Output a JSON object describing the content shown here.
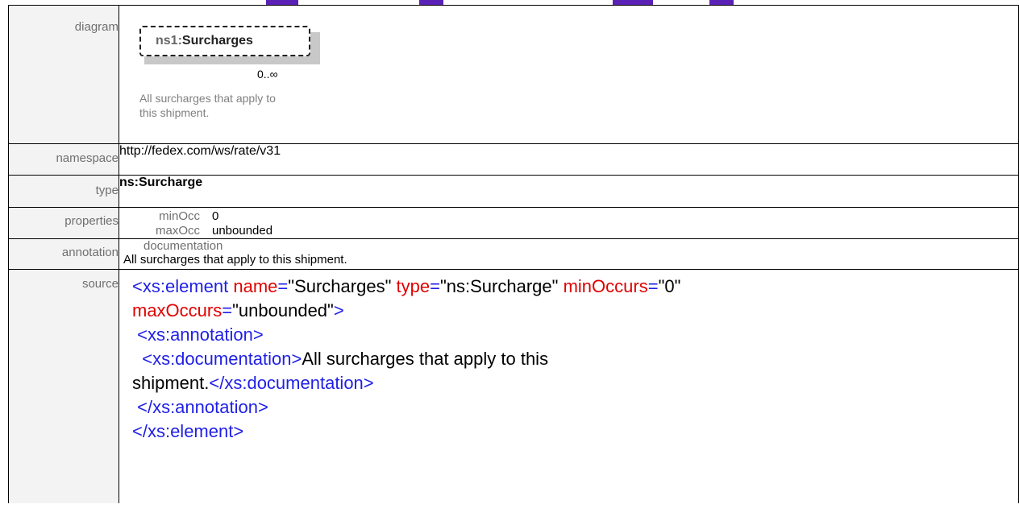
{
  "rows": {
    "diagram": {
      "label": "diagram"
    },
    "namespace": {
      "label": "namespace",
      "value": "http://fedex.com/ws/rate/v31"
    },
    "type": {
      "label": "type",
      "value": "ns:Surcharge"
    },
    "properties": {
      "label": "properties",
      "items": [
        {
          "key": "minOcc",
          "value": "0"
        },
        {
          "key": "maxOcc",
          "value": "unbounded"
        }
      ]
    },
    "annotation": {
      "label": "annotation",
      "key": "documentation",
      "value": "All surcharges that apply to this shipment."
    },
    "source": {
      "label": "source"
    }
  },
  "diagram": {
    "prefix": "ns1:",
    "name": "Surcharges",
    "occurrence": "0..∞",
    "annotation_line1": "All surcharges that apply to",
    "annotation_line2": "this shipment."
  },
  "source_xml": {
    "l1_tag": "<xs:element",
    "l1_a1n": "name",
    "l1_a1v": "\"Surcharges\"",
    "l1_a2n": "type",
    "l1_a2v": "\"ns:Surcharge\"",
    "l1_a3n": "minOccurs",
    "l1_a3v": "\"0\"",
    "l2_a4n": "maxOccurs",
    "l2_a4v": "\"unbounded\"",
    "l2_close": ">",
    "l3": " <xs:annotation>",
    "l4_open": "  <xs:documentation>",
    "l4_text": "All surcharges that apply to this",
    "l5_text": "shipment.",
    "l5_close": "</xs:documentation>",
    "l6": " </xs:annotation>",
    "l7": "</xs:element>"
  },
  "colors": {
    "tag": "#1f1fe6",
    "attr_name": "#e00000",
    "element_name": "#8b0000",
    "label_bg": "#f3f3f3",
    "label_text": "#6f6f6f"
  }
}
